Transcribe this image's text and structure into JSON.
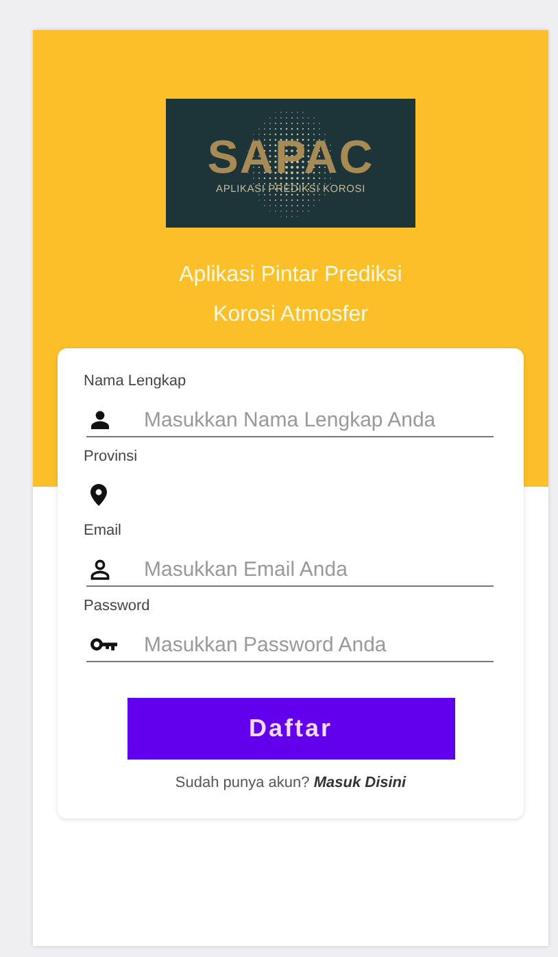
{
  "logo": {
    "title": "SAPAC",
    "subtitle": "APLIKASI PREDIKSI KOROSI"
  },
  "headline": [
    "Aplikasi Pintar Prediksi",
    "Korosi Atmosfer"
  ],
  "form": {
    "fields": [
      {
        "kind": "name",
        "label": "Nama Lengkap",
        "placeholder": "Masukkan Nama Lengkap Anda"
      },
      {
        "kind": "select",
        "label": "Provinsi"
      },
      {
        "kind": "email",
        "label": "Email",
        "placeholder": "Masukkan Email Anda"
      },
      {
        "kind": "password",
        "label": "Password",
        "placeholder": "Masukkan Password Anda"
      }
    ],
    "submit": "Daftar",
    "footer": {
      "text": "Sudah punya akun?",
      "link": "Masuk Disini"
    }
  }
}
